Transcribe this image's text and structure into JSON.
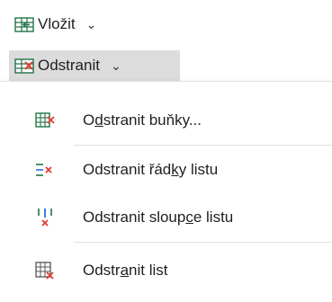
{
  "ribbon": {
    "insert": {
      "label": "Vložit",
      "icon": "insert-cells-icon"
    },
    "delete": {
      "label": "Odstranit",
      "icon": "delete-cells-icon"
    }
  },
  "menu": {
    "items": [
      {
        "label_parts": [
          "O",
          "d",
          "stranit buňky..."
        ],
        "icon": "delete-cells-icon"
      },
      {
        "label_parts": [
          "Odstranit řád",
          "k",
          "y listu"
        ],
        "icon": "delete-rows-icon"
      },
      {
        "label_parts": [
          "Odstranit sloup",
          "c",
          "e listu"
        ],
        "icon": "delete-columns-icon"
      },
      {
        "label_parts": [
          "Odstr",
          "a",
          "nit list"
        ],
        "icon": "delete-sheet-icon"
      }
    ]
  },
  "colors": {
    "accent_green": "#217346",
    "delete_red": "#e03c31",
    "hover_gray": "#dcdcdc"
  }
}
